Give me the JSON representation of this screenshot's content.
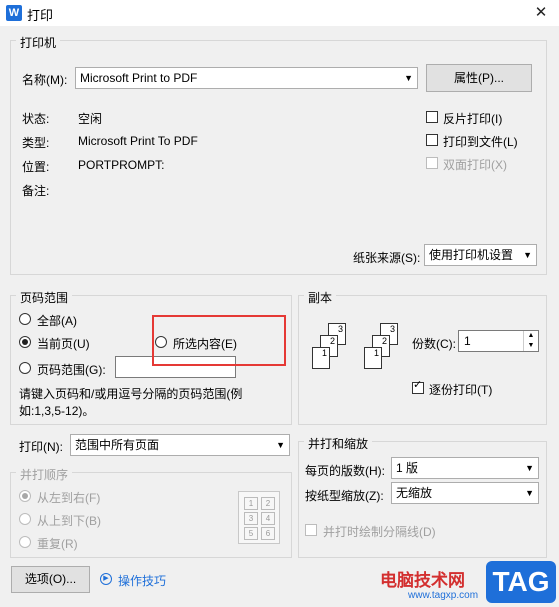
{
  "window": {
    "title": "打印",
    "app_icon": "W"
  },
  "printer_group": {
    "title": "打印机",
    "name_label": "名称(M):",
    "name_value": "Microsoft Print to PDF",
    "properties_button": "属性(P)...",
    "status_label": "状态:",
    "status_value": "空闲",
    "type_label": "类型:",
    "type_value": "Microsoft Print To PDF",
    "where_label": "位置:",
    "where_value": "PORTPROMPT:",
    "comment_label": "备注:",
    "reverse_print": "反片打印(I)",
    "print_to_file": "打印到文件(L)",
    "duplex": "双面打印(X)",
    "paper_source_label": "纸张来源(S):",
    "paper_source_value": "使用打印机设置"
  },
  "page_range": {
    "title": "页码范围",
    "all": "全部(A)",
    "current": "当前页(U)",
    "selection": "所选内容(E)",
    "pages": "页码范围(G):",
    "pages_value": "",
    "hint": "请键入页码和/或用逗号分隔的页码范围(例如:1,3,5-12)。"
  },
  "copies": {
    "title": "副本",
    "count_label": "份数(C):",
    "count_value": "1",
    "collate": "逐份打印(T)"
  },
  "print_what": {
    "label": "打印(N):",
    "value": "范围中所有页面"
  },
  "collate_order": {
    "title": "并打顺序",
    "left_right": "从左到右(F)",
    "top_bottom": "从上到下(B)",
    "repeat": "重复(R)",
    "preview_numbers": [
      "1",
      "2",
      "3",
      "4",
      "5",
      "6"
    ]
  },
  "zoom": {
    "title": "并打和缩放",
    "pages_per_sheet_label": "每页的版数(H):",
    "pages_per_sheet_value": "1 版",
    "scale_label": "按纸型缩放(Z):",
    "scale_value": "无缩放",
    "draw_lines": "并打时绘制分隔线(D)"
  },
  "footer": {
    "options_button": "选项(O)...",
    "tips_link": "操作技巧",
    "watermark_text": "电脑技术网",
    "watermark_url": "www.tagxp.com",
    "watermark_tag": "TAG"
  }
}
